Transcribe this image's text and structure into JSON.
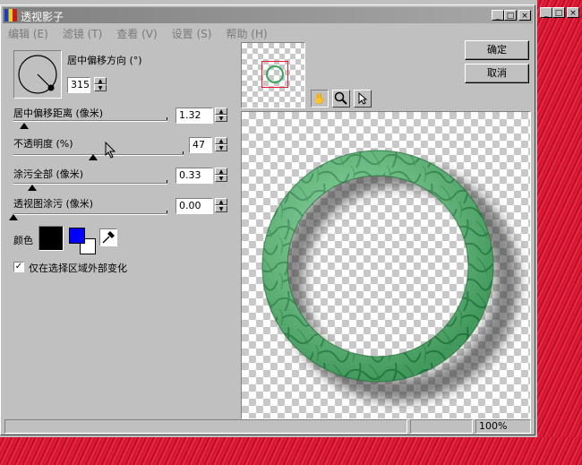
{
  "outer_window": {
    "buttons": [
      "_",
      "□",
      "×"
    ]
  },
  "window": {
    "title": "透视影子",
    "title_buttons": [
      "_",
      "□",
      "×"
    ]
  },
  "menu": [
    {
      "label": "编辑 (E)"
    },
    {
      "label": "滤镜 (T)"
    },
    {
      "label": "查看 (V)"
    },
    {
      "label": "设置 (S)"
    },
    {
      "label": "帮助 (H)"
    }
  ],
  "direction": {
    "label": "居中偏移方向 (°)",
    "value": "315"
  },
  "sliders": [
    {
      "label": "居中偏移距离 (像米)",
      "value": "1.32",
      "fraction": 0.07
    },
    {
      "label": "不透明度 (%)",
      "value": "47",
      "fraction": 0.47
    },
    {
      "label": "涂污全部 (像米)",
      "value": "0.33",
      "fraction": 0.12
    },
    {
      "label": "透视图涂污 (像米)",
      "value": "0.00",
      "fraction": 0.0
    }
  ],
  "color": {
    "label": "颜色",
    "shadow_color": "#000000",
    "fg_color": "#0000ff",
    "bg_color": "#ffffff"
  },
  "checkbox": {
    "label": "仅在选择区域外部变化",
    "checked": true
  },
  "buttons": {
    "ok": "确定",
    "cancel": "取消"
  },
  "status": {
    "zoom": "100%"
  },
  "colors": {
    "accent_red": "#e81c34",
    "ring_green": "#5cc87a"
  }
}
